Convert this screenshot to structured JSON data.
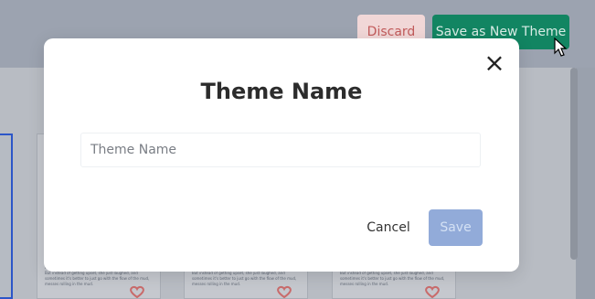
{
  "toolbar": {
    "discard_label": "Discard",
    "save_as_new_label": "Save as New Theme"
  },
  "background_thumbnails": [
    {
      "text": "Finally, She came to a stop, covered head to toe in mud. But instead of getting upset, she just laughed, and sometimes it's better to just go with the flow of the mud, messes rolling in the mud."
    },
    {
      "text": "Finally, She came to a stop, covered head to toe in mud. But instead of getting upset, she just laughed, and sometimes it's better to just go with the flow of the mud, messes rolling in the mud."
    },
    {
      "text": "Finally, She came to a stop, covered head to toe in mud. But instead of getting upset, she just laughed, and sometimes it's better to just go with the flow of the mud, messes rolling in the mud."
    }
  ],
  "modal": {
    "title": "Theme Name",
    "input": {
      "placeholder": "Theme Name",
      "value": ""
    },
    "cancel_label": "Cancel",
    "save_label": "Save",
    "close_symbol": "×"
  },
  "colors": {
    "primary_green": "#128562",
    "discard_red": "#c25b5b",
    "save_disabled": "#92abd9",
    "selection_blue": "#2c56c8"
  },
  "icons": {
    "close": "close-icon",
    "cursor": "cursor-icon",
    "heart": "heart-icon"
  }
}
